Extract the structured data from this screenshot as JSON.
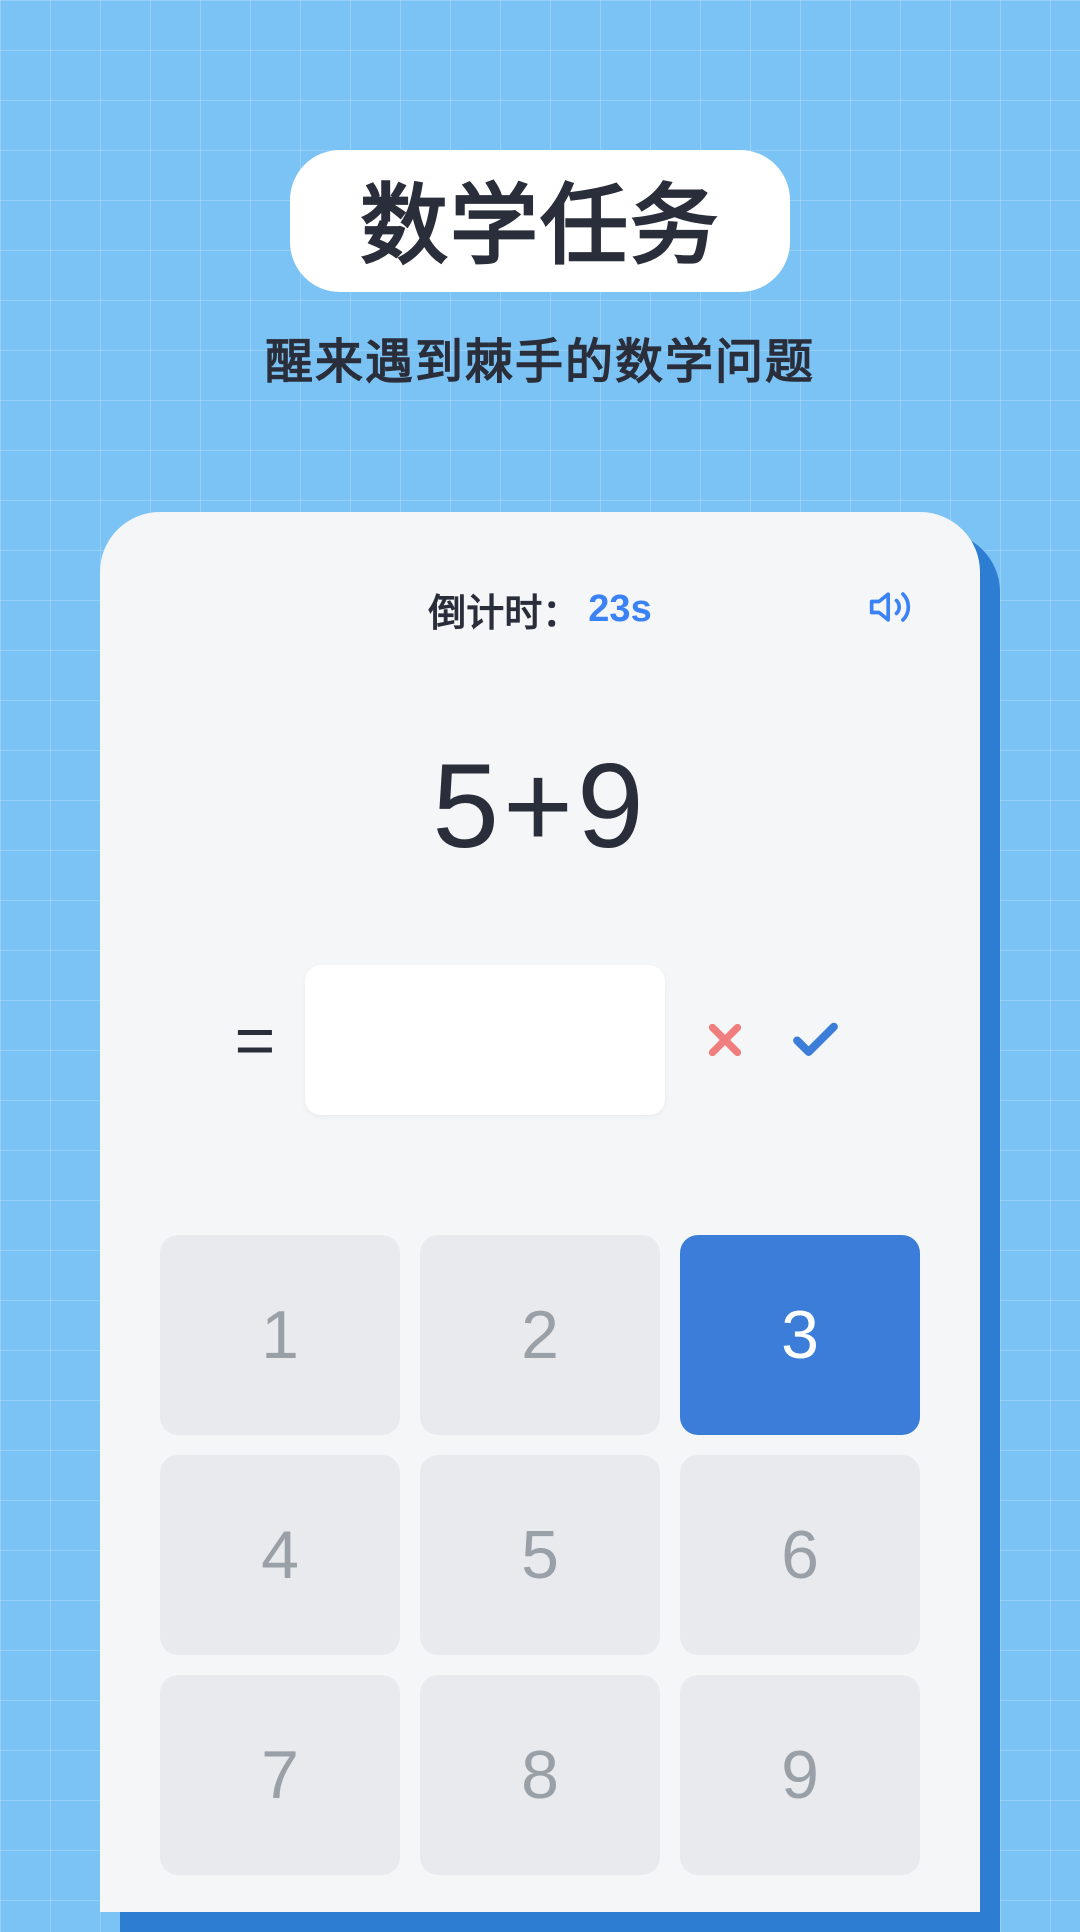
{
  "header": {
    "title": "数学任务",
    "subtitle": "醒来遇到棘手的数学问题"
  },
  "countdown": {
    "label": "倒计时：",
    "value": "23s"
  },
  "problem": {
    "question": "5+9",
    "equals": "=",
    "answer": ""
  },
  "keypad": {
    "keys": [
      "1",
      "2",
      "3",
      "4",
      "5",
      "6",
      "7",
      "8",
      "9"
    ],
    "active_index": 2
  },
  "colors": {
    "accent": "#3b7dd8",
    "background": "#7cc3f5"
  }
}
